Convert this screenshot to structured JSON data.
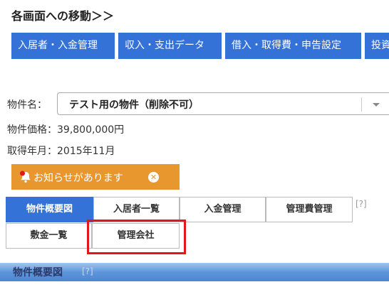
{
  "header": {
    "title": "各画面への移動＞＞"
  },
  "nav": {
    "items": [
      {
        "label": "入居者・入金管理"
      },
      {
        "label": "収入・支出データ"
      },
      {
        "label": "借入・取得費・申告設定"
      },
      {
        "label": "投資"
      }
    ]
  },
  "property": {
    "name_label": "物件名：",
    "selected": "テスト用の物件（削除不可）",
    "price_text": "物件価格：39,800,000円",
    "acquired_text": "取得年月：2015年11月"
  },
  "notice": {
    "text": "お知らせがあります",
    "close_glyph": "✕"
  },
  "tabs": {
    "row1": [
      "物件概要図",
      "入居者一覧",
      "入金管理",
      "管理費管理"
    ],
    "row2": [
      "敷金一覧",
      "管理会社"
    ],
    "help": "[?]"
  },
  "section": {
    "title": "物件概要図",
    "help": "[?]"
  },
  "colors": {
    "accent": "#3572d8",
    "notice": "#e8972e",
    "highlight": "#e2161c"
  }
}
